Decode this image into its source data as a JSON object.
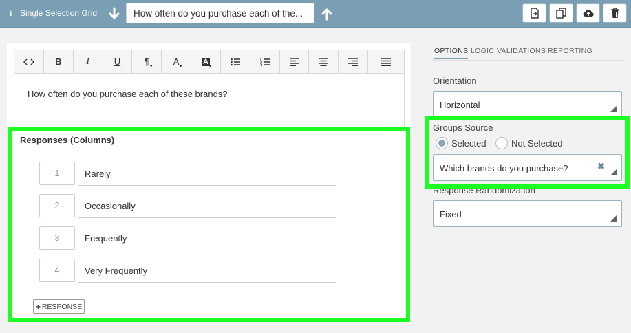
{
  "topbar": {
    "question_type": "Single Selection Grid",
    "title": "How often do you purchase each of the...",
    "buttons": [
      "export-icon",
      "duplicate-icon",
      "cloud-upload-icon",
      "trash-icon"
    ]
  },
  "toolbar": {
    "tools": [
      "code",
      "bold",
      "italic",
      "underline",
      "paragraph",
      "font-color",
      "background-color",
      "bulleted-list",
      "numbered-list",
      "align-left",
      "align-center",
      "align-right",
      "justify"
    ]
  },
  "question": {
    "text": "How often do you purchase each of these brands?"
  },
  "responses": {
    "title": "Responses (Columns)",
    "items": [
      {
        "num": "1",
        "label": "Rarely"
      },
      {
        "num": "2",
        "label": "Occasionally"
      },
      {
        "num": "3",
        "label": "Frequently"
      },
      {
        "num": "4",
        "label": "Very Frequently"
      }
    ],
    "add_label": "RESPONSE"
  },
  "panel": {
    "tabs": [
      "OPTIONS",
      "LOGIC",
      "VALIDATIONS",
      "REPORTING"
    ],
    "orientation": {
      "label": "Orientation",
      "value": "Horizontal"
    },
    "groups_source": {
      "label": "Groups Source",
      "selected": "Selected",
      "not_selected": "Not Selected",
      "value": "Which brands do you purchase?"
    },
    "randomization": {
      "label": "Response Randomization",
      "value": "Fixed"
    }
  },
  "colors": {
    "topbar": "#7a9fb5",
    "highlight": "#1cff22"
  }
}
